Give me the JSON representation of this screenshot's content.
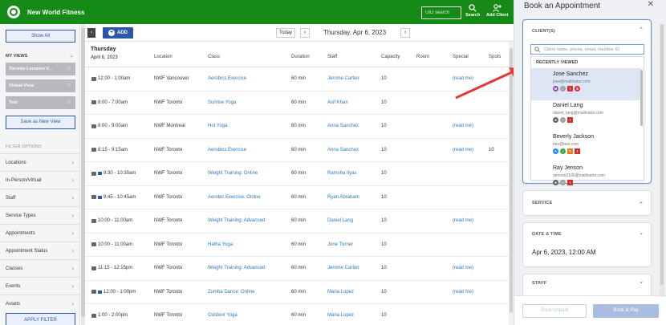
{
  "app": {
    "brand": "New World Fitness",
    "uid_search_placeholder": "UID search",
    "search_label": "Search",
    "add_client_label": "Add Client"
  },
  "sidebar": {
    "show_all": "Show All",
    "my_views_label": "MY VIEWS",
    "views": [
      "Toronto Location V...",
      "Virtual View",
      "Test"
    ],
    "save_view": "Save as New View",
    "filter_options_label": "FILTER OPTIONS",
    "filters": [
      "Locations",
      "In-Person/Virtual",
      "Staff",
      "Service Types",
      "Appointments",
      "Appointment Status",
      "Classes",
      "Events",
      "Assets"
    ],
    "apply_filter": "APPLY FILTER"
  },
  "toolbar": {
    "add_label": "ADD",
    "today_label": "Today",
    "current_date": "Thursday, Apr 6, 2023"
  },
  "schedule": {
    "day": "Thursday",
    "date": "April 6, 2023",
    "columns": [
      "Location",
      "Class",
      "Duration",
      "Staff",
      "Capacity",
      "Room",
      "Special",
      "Spots"
    ],
    "rows": [
      {
        "time": "12:00 - 1:00am",
        "video": false,
        "location": "NWF Vancouver",
        "class": "Aerobics Exercise",
        "duration": "60 min",
        "staff": "Jerome Cartier",
        "capacity": "10",
        "special": "(read me)",
        "spots": ""
      },
      {
        "time": "8:00 - 7:00am",
        "video": false,
        "location": "NWF Toronto",
        "class": "Sunrise Yoga",
        "duration": "60 min",
        "staff": "Asif Khan",
        "capacity": "10",
        "special": "",
        "spots": ""
      },
      {
        "time": "8:00 - 9:00am",
        "video": false,
        "location": "NWF Montreal",
        "class": "Hot Yoga",
        "duration": "60 min",
        "staff": "Anna Sanchez",
        "capacity": "10",
        "special": "(read me)",
        "spots": ""
      },
      {
        "time": "8:15 - 9:15am",
        "video": false,
        "location": "NWF Toronto",
        "class": "Aerobics Exercise",
        "duration": "60 min",
        "staff": "Anna Sanchez",
        "capacity": "10",
        "special": "(read me)",
        "spots": "10"
      },
      {
        "time": "9:30 - 10:30am",
        "video": true,
        "location": "NWF Toronto",
        "class": "Weight Training: Online",
        "duration": "60 min",
        "staff": "Ramsha Ilyas",
        "capacity": "10",
        "special": "",
        "spots": ""
      },
      {
        "time": "9:45 - 10:45am",
        "video": true,
        "location": "NWF Toronto",
        "class": "Aerobic Exercise: Online",
        "duration": "60 min",
        "staff": "Ryan Abraham",
        "capacity": "10",
        "special": "",
        "spots": ""
      },
      {
        "time": "10:00 - 11:00am",
        "video": false,
        "location": "NWF Toronto",
        "class": "Weight Training: Advanced",
        "duration": "60 min",
        "staff": "Daniel Lang",
        "capacity": "10",
        "special": "(read me)",
        "spots": ""
      },
      {
        "time": "10:00 - 11:00am",
        "video": false,
        "location": "NWF Toronto",
        "class": "Hatha Yoga",
        "duration": "60 min",
        "staff": "Jone Turner",
        "capacity": "10",
        "special": "",
        "spots": ""
      },
      {
        "time": "11:15 - 12:15pm",
        "video": false,
        "location": "NWF Toronto",
        "class": "Weight Training: Advanced",
        "duration": "60 min",
        "staff": "Jerome Cartier",
        "capacity": "10",
        "special": "(read me)",
        "spots": ""
      },
      {
        "time": "12:00 - 1:00pm",
        "video": true,
        "location": "NWF Toronto",
        "class": "Zumba Dance: Online",
        "duration": "60 min",
        "staff": "Maria Lopez",
        "capacity": "10",
        "special": "(read me)",
        "spots": ""
      },
      {
        "time": "1:00 - 2:00pm",
        "video": false,
        "location": "NWF Toronto",
        "class": "Outdoor Yoga",
        "duration": "60 min",
        "staff": "Maria Lopez",
        "capacity": "10",
        "special": "",
        "spots": ""
      }
    ]
  },
  "panel": {
    "title": "Book an Appointment",
    "client_label": "CLIENT(S)",
    "client_placeholder": "Client name, phone, email, member ID",
    "recent_label": "RECENTLY VIEWED",
    "clients": [
      {
        "name": "Jose Sanchez",
        "email": "jose@mailinator.com",
        "badges": [
          {
            "t": "M",
            "c": "#8e44ad",
            "shape": "circle"
          },
          {
            "t": "✓",
            "c": "#9aa0a6",
            "shape": "circle"
          },
          {
            "t": "!",
            "c": "#d32f2f",
            "shape": "square"
          },
          {
            "t": "$",
            "c": "#d32f2f",
            "shape": "circle"
          }
        ]
      },
      {
        "name": "Daniel Lang",
        "email": "daniel_lang@mailinator.com",
        "badges": [
          {
            "t": "★",
            "c": "#5f6368",
            "shape": "circle"
          },
          {
            "t": "✓",
            "c": "#9aa0a6",
            "shape": "circle"
          },
          {
            "t": "!",
            "c": "#d32f2f",
            "shape": "square"
          }
        ]
      },
      {
        "name": "Beverly Jackson",
        "email": "bev@test.com",
        "badges": [
          {
            "t": "A",
            "c": "#1e88e5",
            "shape": "circle"
          },
          {
            "t": "✓",
            "c": "#43a047",
            "shape": "circle"
          },
          {
            "t": "✎",
            "c": "#e67e22",
            "shape": "square"
          },
          {
            "t": "!",
            "c": "#d32f2f",
            "shape": "square"
          }
        ]
      },
      {
        "name": "Ray Jenson",
        "email": "rjenson3100@mailinator.com",
        "badges": [
          {
            "t": "★",
            "c": "#5f6368",
            "shape": "circle"
          },
          {
            "t": "✓",
            "c": "#9aa0a6",
            "shape": "circle"
          },
          {
            "t": "!",
            "c": "#d32f2f",
            "shape": "square"
          }
        ]
      }
    ],
    "service_label": "SERVICE",
    "datetime_label": "DATE & TIME",
    "datetime_value": "Apr 6, 2023, 12:00 AM",
    "staff_label": "STAFF",
    "book_unpaid": "Book Unpaid",
    "book_pay": "Book & Pay"
  },
  "colors": {
    "topbar": "#168a16",
    "primary": "#2b59a8",
    "link": "#2b79c2",
    "arrow": "#e53935"
  }
}
